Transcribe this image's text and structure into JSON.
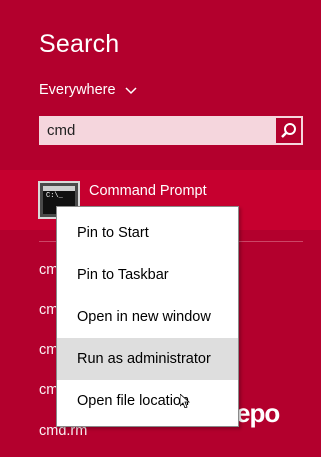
{
  "search": {
    "title": "Search",
    "scope_label": "Everywhere",
    "query": "cmd"
  },
  "results": {
    "top": {
      "label": "Command Prompt",
      "icon": "command-prompt-icon",
      "icon_text": "C:\\_"
    },
    "others": [
      "cmd",
      "cmd",
      "cmd",
      "cmd",
      "cmd.rm"
    ]
  },
  "context_menu": {
    "items": [
      "Pin to Start",
      "Pin to Taskbar",
      "Open in new window",
      "Run as administrator",
      "Open file location"
    ],
    "highlighted_index": 3
  },
  "watermark": {
    "text": "epo"
  },
  "colors": {
    "background": "#b3002d",
    "selected_result": "#c6002f",
    "search_field": "#f5d6dd",
    "menu_hover": "#dedede"
  }
}
